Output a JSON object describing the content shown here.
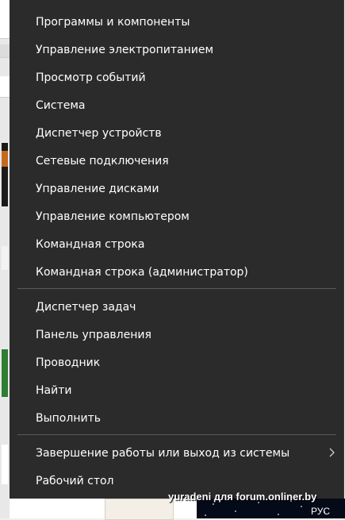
{
  "menu": {
    "group1": [
      {
        "label": "Программы и компоненты"
      },
      {
        "label": "Управление электропитанием"
      },
      {
        "label": "Просмотр событий"
      },
      {
        "label": "Система"
      },
      {
        "label": "Диспетчер устройств"
      },
      {
        "label": "Сетевые подключения"
      },
      {
        "label": "Управление дисками"
      },
      {
        "label": "Управление компьютером"
      },
      {
        "label": "Командная строка"
      },
      {
        "label": "Командная строка (администратор)"
      }
    ],
    "group2": [
      {
        "label": "Диспетчер задач"
      },
      {
        "label": "Панель управления"
      },
      {
        "label": "Проводник"
      },
      {
        "label": "Найти"
      },
      {
        "label": "Выполнить"
      }
    ],
    "group3": [
      {
        "label": "Завершение работы или выход из системы",
        "submenu_icon": "chevron-right-icon"
      },
      {
        "label": "Рабочий стол"
      }
    ]
  },
  "watermark": "yuradeni для forum.onliner.by",
  "taskbar": {
    "language": "РУС"
  },
  "colors": {
    "menu_bg": "#2b2b2b",
    "separator": "#5a5a5a",
    "text": "#ffffff"
  }
}
